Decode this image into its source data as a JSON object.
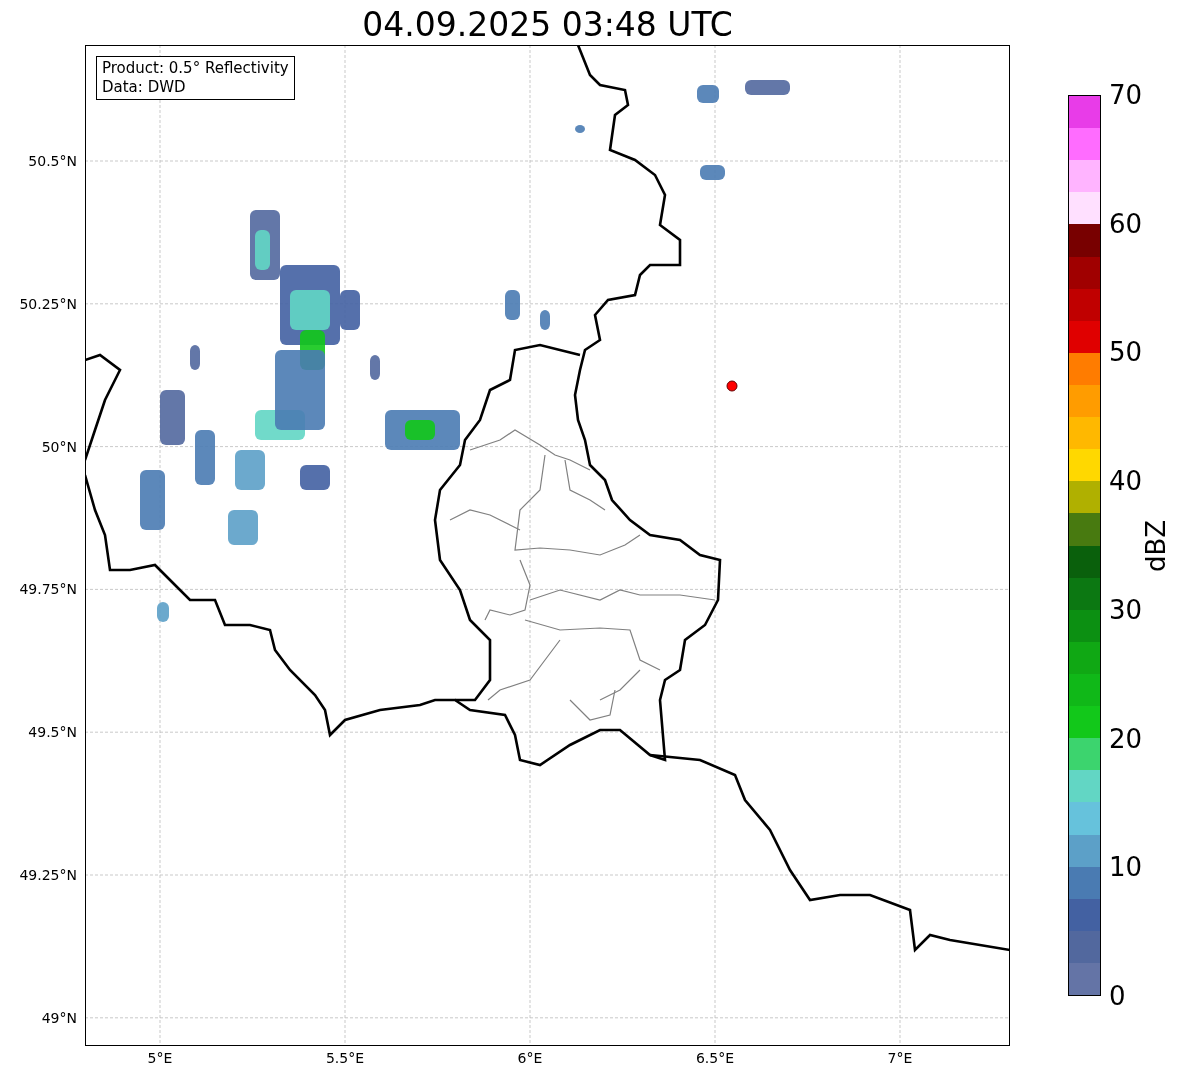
{
  "title": "04.09.2025 03:48 UTC",
  "legend": [
    "Product: 0.5° Reflectivity",
    "Data: DWD"
  ],
  "lat_labels": [
    "50.5°N",
    "50.25°N",
    "50°N",
    "49.75°N",
    "49.5°N",
    "49.25°N",
    "49°N"
  ],
  "lon_labels": [
    "5°E",
    "5.5°E",
    "6°E",
    "6.5°E",
    "7°E"
  ],
  "colorbar": {
    "label": "dBZ",
    "ticks": [
      "70",
      "60",
      "50",
      "40",
      "30",
      "20",
      "10",
      "0"
    ],
    "segments": [
      {
        "color": "#e83ce8"
      },
      {
        "color": "#ff6cff"
      },
      {
        "color": "#ffb4ff"
      },
      {
        "color": "#ffe0ff"
      },
      {
        "color": "#780000"
      },
      {
        "color": "#a00000"
      },
      {
        "color": "#c00000"
      },
      {
        "color": "#e00000"
      },
      {
        "color": "#ff7c00"
      },
      {
        "color": "#ff9c00"
      },
      {
        "color": "#ffb800"
      },
      {
        "color": "#ffd800"
      },
      {
        "color": "#b0b000"
      },
      {
        "color": "#487a10"
      },
      {
        "color": "#0a600c"
      },
      {
        "color": "#0c7812"
      },
      {
        "color": "#0c9012"
      },
      {
        "color": "#10a814"
      },
      {
        "color": "#10b818"
      },
      {
        "color": "#12c81a"
      },
      {
        "color": "#3cd46e"
      },
      {
        "color": "#62d6c4"
      },
      {
        "color": "#66c2dc"
      },
      {
        "color": "#5ca0c8"
      },
      {
        "color": "#4a7bb2"
      },
      {
        "color": "#4361a2"
      },
      {
        "color": "#52689e"
      },
      {
        "color": "#6474a6"
      }
    ]
  }
}
